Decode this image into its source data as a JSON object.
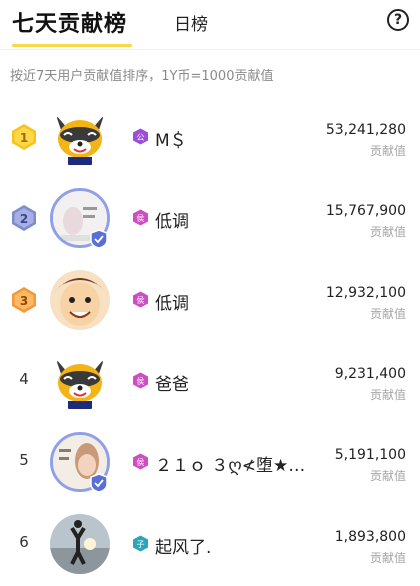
{
  "header": {
    "tab_active": "七天贡献榜",
    "tab_inactive": "日榜",
    "help_symbol": "?"
  },
  "subtitle": "按近7天用户贡献值排序，1Y币=1000贡献值",
  "colors": {
    "tab_underline": "#f7d84a",
    "gold_medal": "#f6c51c",
    "silver_medal": "#7f8ccc",
    "bronze_medal": "#f19a3c",
    "level_purple": "#b456d6",
    "level_pink": "#cc4ec0",
    "level_teal": "#2aa6b8"
  },
  "rows": [
    {
      "rank": "1",
      "name": "M＄",
      "value": "53,241,280",
      "value_label": "贡献值",
      "level_icon": "crown-level-icon"
    },
    {
      "rank": "2",
      "name": "低调",
      "value": "15,767,900",
      "value_label": "贡献值",
      "level_icon": "level-badge-icon"
    },
    {
      "rank": "3",
      "name": "低调",
      "value": "12,932,100",
      "value_label": "贡献值",
      "level_icon": "level-badge-icon"
    },
    {
      "rank": "4",
      "name": "爸爸",
      "value": "9,231,400",
      "value_label": "贡献值",
      "level_icon": "level-badge-icon"
    },
    {
      "rank": "5",
      "name": "２１ｏ ３ღ≮堕★…",
      "value": "5,191,100",
      "value_label": "贡献值",
      "level_icon": "level-badge-icon"
    },
    {
      "rank": "6",
      "name": "起风了.",
      "value": "1,893,800",
      "value_label": "贡献值",
      "level_icon": "level-badge-icon"
    }
  ]
}
